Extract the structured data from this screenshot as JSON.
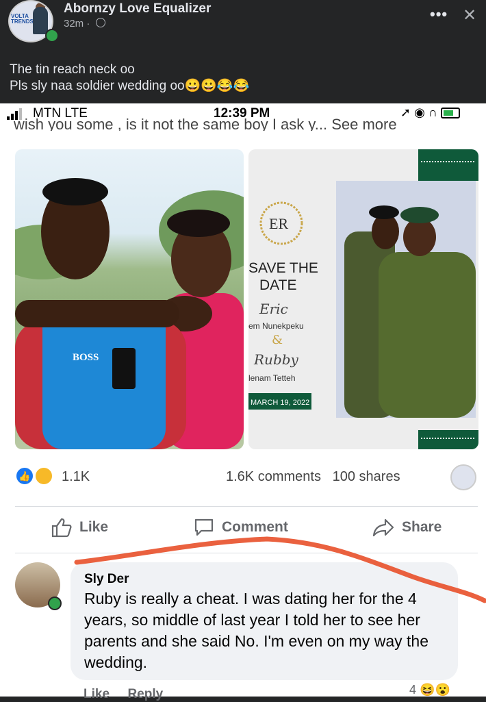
{
  "post": {
    "author": "Abornzy Love Equalizer",
    "time": "32m",
    "caption_line1": "The tin reach neck oo",
    "caption_line2": "Pls sly naa soldier wedding oo",
    "caption_emoji": "😀😀😂😂",
    "more_icon": "more-dots-icon",
    "close_icon": "close-icon",
    "avatar_logo": "VOLTA TRENDS"
  },
  "status_bar": {
    "carrier": "MTN  LTE",
    "time": "12:39 PM"
  },
  "shared": {
    "cutoff_text": "wish you some , is it not the same boy I ask y... See more",
    "invite": {
      "monogram": "ER",
      "save_line1": "SAVE THE",
      "save_line2": "DATE",
      "groom_first": "Eric",
      "groom_last": "em Nunekpeku",
      "amp": "&",
      "bride_first": "Rubby",
      "bride_last": "lenam Tetteh",
      "date": "MARCH 19, 2022"
    },
    "shirt_brand": "BOSS"
  },
  "engagement": {
    "reaction_count": "1.1K",
    "comments": "1.6K comments",
    "shares": "100 shares"
  },
  "actions": {
    "like": "Like",
    "comment": "Comment",
    "share": "Share"
  },
  "comment": {
    "name": "Sly Der",
    "text": "Ruby is really a cheat. I was dating her for the 4 years, so middle of last year I told her to see her parents and she said No. I'm even on my way the wedding.",
    "like": "Like",
    "reply": "Reply",
    "reaction_count": "4"
  },
  "colors": {
    "dark_bg": "#242526",
    "fb_blue": "#1877f2",
    "annotation_red": "#e8502a",
    "online_green": "#31a24c",
    "invite_green": "#0f5a3a"
  }
}
